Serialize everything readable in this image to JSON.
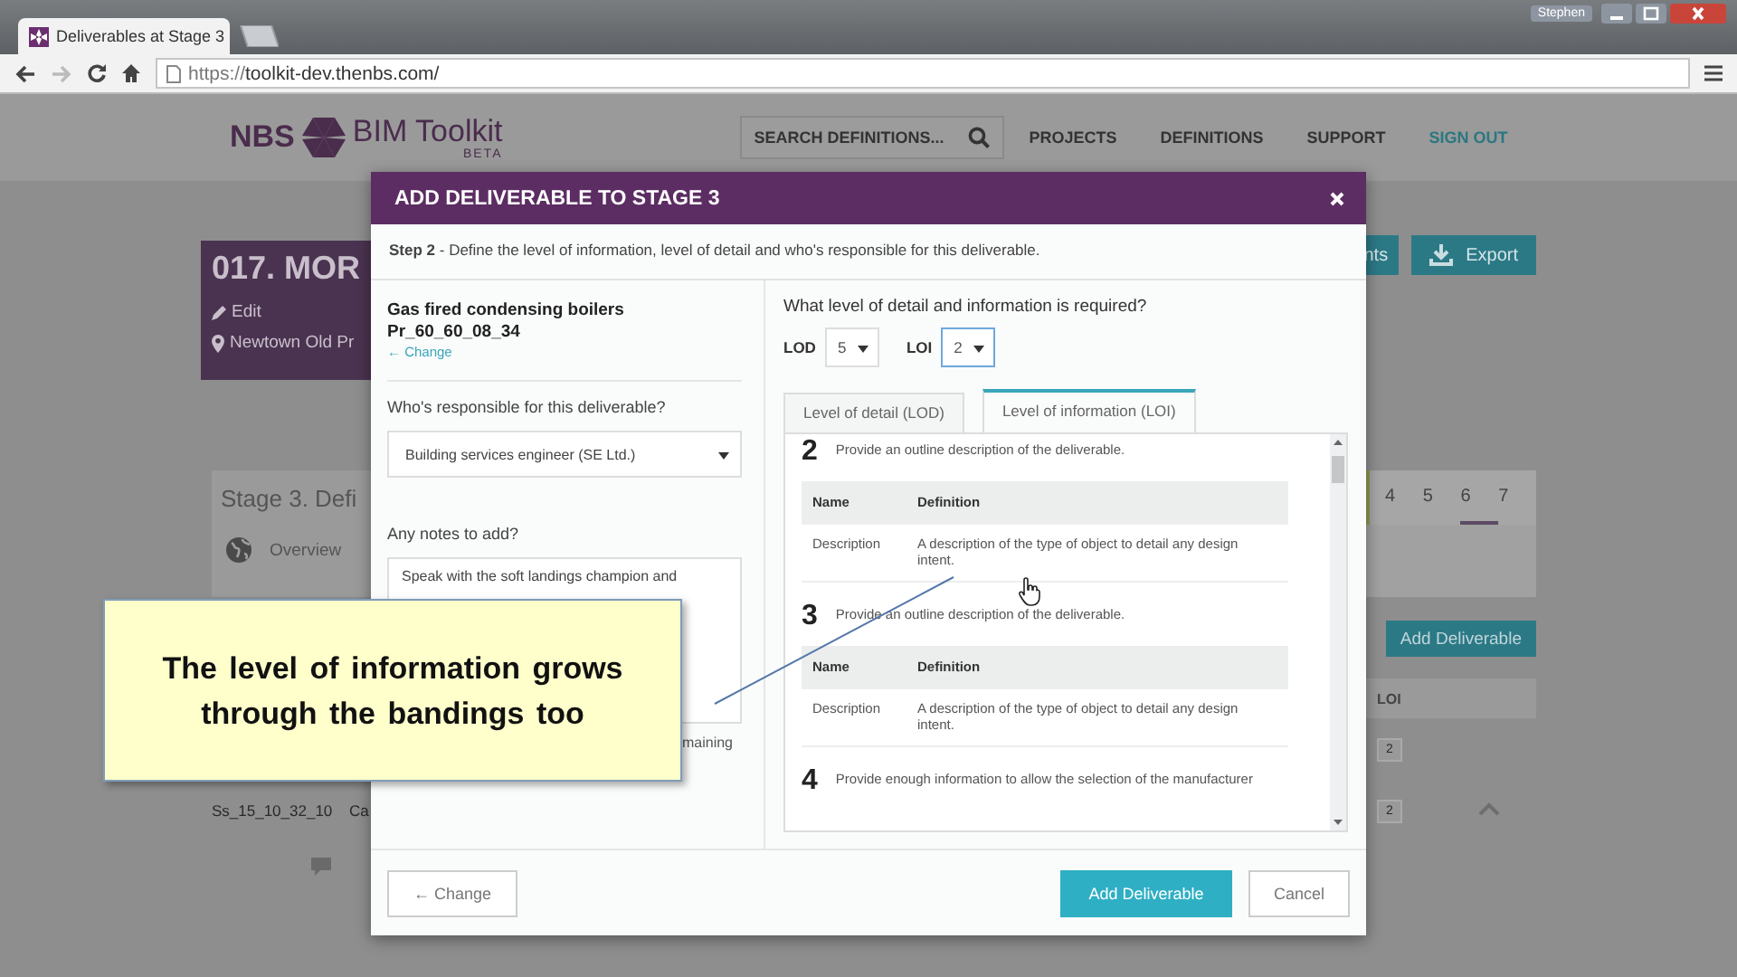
{
  "browser": {
    "tabs": [
      {
        "title": "Deliverables at Stage 3",
        "selected": true
      }
    ],
    "profile": "Stephen",
    "url_scheme": "https://",
    "url_host": "toolkit-dev.thenbs.com/",
    "forward_disabled": true
  },
  "site": {
    "logo": "NBS",
    "product": "BIM Toolkit",
    "badge": "BETA",
    "search_placeholder": "SEARCH DEFINITIONS...",
    "nav": [
      {
        "label": "PROJECTS",
        "kind": "link"
      },
      {
        "label": "DEFINITIONS",
        "kind": "link"
      },
      {
        "label": "SUPPORT",
        "kind": "link"
      },
      {
        "label": "SIGN OUT",
        "kind": "action"
      }
    ]
  },
  "project": {
    "title": "017. MOR",
    "edit": "Edit",
    "location": "Newtown Old Pr"
  },
  "project_actions": [
    {
      "label": "nts",
      "kind": "plain"
    },
    {
      "label": "Export",
      "kind": "download"
    }
  ],
  "stage": {
    "title": "Stage 3. Defi",
    "overview": "Overview",
    "stages": [
      {
        "label": "4",
        "marked": false
      },
      {
        "label": "5",
        "marked": false
      },
      {
        "label": "6",
        "marked": true
      },
      {
        "label": "7",
        "marked": false
      }
    ]
  },
  "deliverables": {
    "add_button": "Add Deliverable",
    "columns": [
      "LOI"
    ],
    "rows": [
      {
        "code": "",
        "name": "",
        "loi": "2"
      },
      {
        "code": "Ss_15_10_32_10",
        "name": "Ca",
        "loi": "2",
        "expanded": true
      }
    ]
  },
  "modal": {
    "title": "ADD DELIVERABLE TO STAGE 3",
    "step": "**Step 2** - Define the level of information, level of detail and who's responsible for this deliverable.",
    "product": "Gas fired condensing boilers",
    "code": "Pr_60_60_08_34",
    "change_link": "← Change",
    "responsible_label": "Who's responsible for this deliverable?",
    "responsible_value": "Building services engineer (SE Ltd.)",
    "notes_label": "Any notes to add?",
    "notes_value": "Speak with the soft landings champion and",
    "remaining": "maining",
    "question": "What level of detail and information is required?",
    "selects": [
      {
        "label": "LOD",
        "value": "5",
        "focused": false
      },
      {
        "label": "LOI",
        "value": "2",
        "focused": true
      }
    ],
    "tabs": [
      {
        "label": "Level of detail (LOD)",
        "selected": false
      },
      {
        "label": "Level of information (LOI)",
        "selected": true
      }
    ],
    "levels": [
      {
        "number": "2",
        "description": "Provide an outline description of the deliverable.",
        "columns": [
          "Name",
          "Definition"
        ],
        "rows": [
          {
            "name": "Description",
            "definition": "A description of the type of object to detail any design intent."
          }
        ]
      },
      {
        "number": "3",
        "description": "Provide an outline description of the deliverable.",
        "columns": [
          "Name",
          "Definition"
        ],
        "rows": [
          {
            "name": "Description",
            "definition": "A description of the type of object to detail any design intent."
          }
        ]
      },
      {
        "number": "4",
        "description": "Provide enough information to allow the selection of the manufacturer"
      }
    ],
    "buttons": [
      {
        "label": "← Change",
        "kind": "back"
      },
      {
        "label": "Add Deliverable",
        "kind": "primary"
      },
      {
        "label": "Cancel",
        "kind": "secondary"
      }
    ]
  },
  "callout": {
    "text": "The level of information grows through the bandings too"
  }
}
